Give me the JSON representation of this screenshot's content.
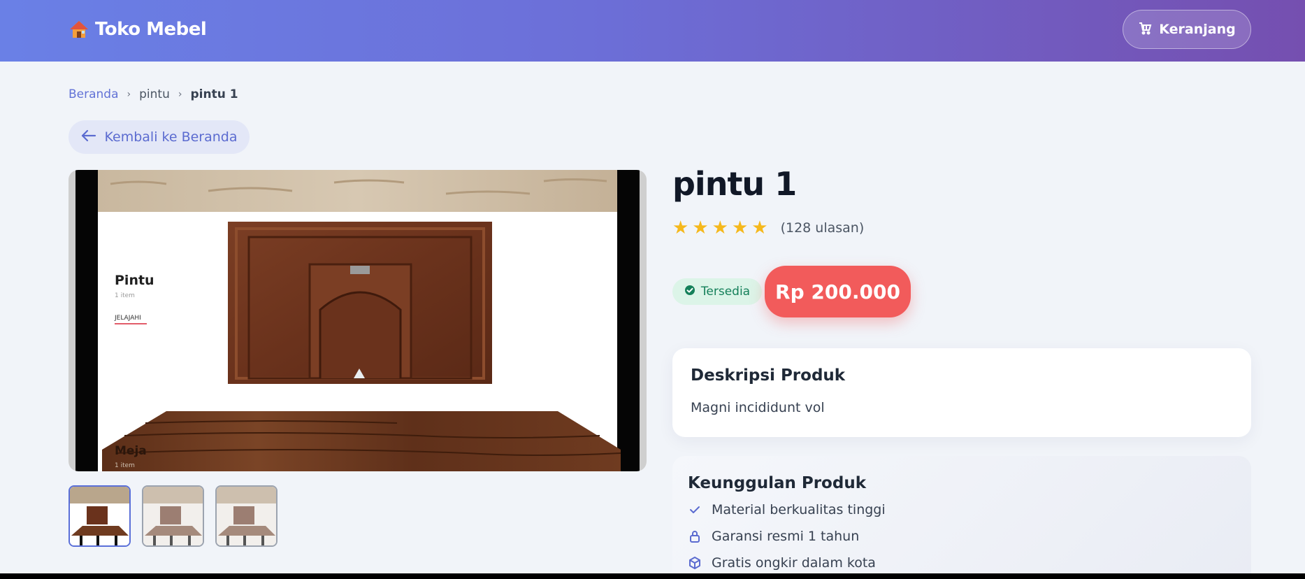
{
  "header": {
    "brand_name": "Toko Mebel",
    "brand_icon": "house-icon",
    "cart_label": "Keranjang",
    "cart_icon": "cart-icon"
  },
  "breadcrumb": {
    "home": "Beranda",
    "category": "pintu",
    "current": "pintu 1"
  },
  "back_button": {
    "label": "Kembali ke Beranda",
    "icon": "arrow-left-icon"
  },
  "gallery": {
    "main_image_labels": {
      "category_title": "Pintu",
      "category_count": "1 item",
      "category_link": "JELAJAHI",
      "second_title": "Meja",
      "second_count": "1 item"
    },
    "thumbnail_count": 3,
    "active_thumbnail": 1
  },
  "product": {
    "name": "pintu 1",
    "rating": 5,
    "review_text": "(128 ulasan)",
    "stock_label": "Tersedia",
    "price": "Rp 200.000"
  },
  "description": {
    "heading": "Deskripsi Produk",
    "text": "Magni incididunt vol"
  },
  "advantages": {
    "heading": "Keunggulan Produk",
    "items": [
      {
        "icon": "check-icon",
        "label": "Material berkualitas tinggi"
      },
      {
        "icon": "lock-icon",
        "label": "Garansi resmi 1 tahun"
      },
      {
        "icon": "box-icon",
        "label": "Gratis ongkir dalam kota"
      }
    ]
  },
  "colors": {
    "accent": "#6272d6",
    "price_bg": "#f25b5b",
    "star": "#f5b81c",
    "stock_bg": "#dcf4e8",
    "stock_text": "#15805a"
  }
}
